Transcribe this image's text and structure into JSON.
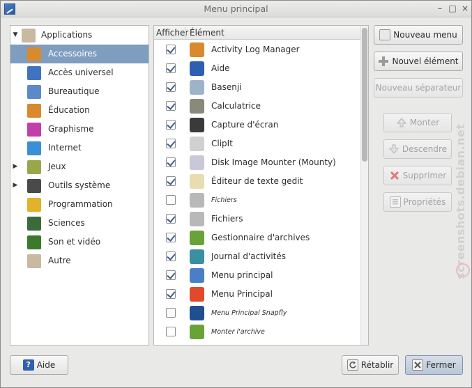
{
  "window": {
    "title": "Menu principal",
    "controls": {
      "minimize": "–",
      "maximize": "□",
      "close": "×"
    }
  },
  "categories": [
    {
      "label": "Applications",
      "icon": "applications-icon",
      "expander": "▼",
      "level": 0,
      "color": "#c8b9a0"
    },
    {
      "label": "Accessoires",
      "icon": "accessories-icon",
      "selected": true,
      "level": 1,
      "color": "#d98a2c"
    },
    {
      "label": "Accès universel",
      "icon": "accessibility-icon",
      "level": 1,
      "color": "#3f73c0"
    },
    {
      "label": "Bureautique",
      "icon": "office-icon",
      "level": 1,
      "color": "#5a8ac9"
    },
    {
      "label": "Éducation",
      "icon": "education-icon",
      "level": 1,
      "color": "#d98a2c"
    },
    {
      "label": "Graphisme",
      "icon": "graphics-icon",
      "level": 1,
      "color": "#c23fa9"
    },
    {
      "label": "Internet",
      "icon": "internet-icon",
      "level": 1,
      "color": "#3a8fd6"
    },
    {
      "label": "Jeux",
      "icon": "games-icon",
      "expander": "▶",
      "level": 1,
      "color": "#9aa64a"
    },
    {
      "label": "Outils système",
      "icon": "system-tools-icon",
      "expander": "▶",
      "level": 1,
      "color": "#4a4a4a"
    },
    {
      "label": "Programmation",
      "icon": "programming-icon",
      "level": 1,
      "color": "#e2b22a"
    },
    {
      "label": "Sciences",
      "icon": "science-icon",
      "level": 1,
      "color": "#3b6b3b"
    },
    {
      "label": "Son et vidéo",
      "icon": "sound-video-icon",
      "level": 1,
      "color": "#3a7a2a"
    },
    {
      "label": "Autre",
      "icon": "other-icon",
      "level": 1,
      "color": "#c8b9a0"
    }
  ],
  "list": {
    "col_show": "Afficher",
    "col_item": "Élément",
    "items": [
      {
        "label": "Activity Log Manager",
        "checked": true,
        "icon": "activity-log-icon",
        "color": "#d98a2c"
      },
      {
        "label": "Aide",
        "checked": true,
        "icon": "help-icon",
        "color": "#2f5fb0"
      },
      {
        "label": "Basenji",
        "checked": true,
        "icon": "basenji-icon",
        "color": "#9fb3c8"
      },
      {
        "label": "Calculatrice",
        "checked": true,
        "icon": "calculator-icon",
        "color": "#8a8a7a"
      },
      {
        "label": "Capture d'écran",
        "checked": true,
        "icon": "screenshot-icon",
        "color": "#3a3a3a"
      },
      {
        "label": "ClipIt",
        "checked": true,
        "icon": "clipboard-icon",
        "color": "#d0d0d0"
      },
      {
        "label": "Disk Image Mounter (Mounty)",
        "checked": true,
        "icon": "disk-icon",
        "color": "#c8c8d8"
      },
      {
        "label": "Éditeur de texte gedit",
        "checked": true,
        "icon": "text-editor-icon",
        "color": "#e8dcb0"
      },
      {
        "label": "Fichiers",
        "checked": false,
        "hidden": true,
        "icon": "files-icon",
        "color": "#b8b8b8"
      },
      {
        "label": "Fichiers",
        "checked": true,
        "icon": "files-icon",
        "color": "#b8b8b8"
      },
      {
        "label": "Gestionnaire d'archives",
        "checked": true,
        "icon": "archive-icon",
        "color": "#6aa23a"
      },
      {
        "label": "Journal d'activités",
        "checked": true,
        "icon": "journal-icon",
        "color": "#3a8fa0"
      },
      {
        "label": "Menu principal",
        "checked": true,
        "icon": "main-menu-icon",
        "color": "#4a7fc6"
      },
      {
        "label": "Menu Principal",
        "checked": true,
        "icon": "main-menu-tiles-icon",
        "color": "#e04a2a"
      },
      {
        "label": "Menu Principal Snapfly",
        "checked": false,
        "hidden": true,
        "icon": "snapfly-icon",
        "color": "#1f4f8f"
      },
      {
        "label": "Monter l'archive",
        "checked": false,
        "hidden": true,
        "icon": "mount-archive-icon",
        "color": "#6aa23a"
      }
    ]
  },
  "buttons": {
    "new_menu": "Nouveau menu",
    "new_item": "Nouvel élément",
    "new_separator": "Nouveau séparateur",
    "move_up": "Monter",
    "move_down": "Descendre",
    "delete": "Supprimer",
    "properties": "Propriétés",
    "help": "Aide",
    "revert": "Rétablir",
    "close": "Fermer"
  },
  "watermark": "screenshots.debian.net"
}
